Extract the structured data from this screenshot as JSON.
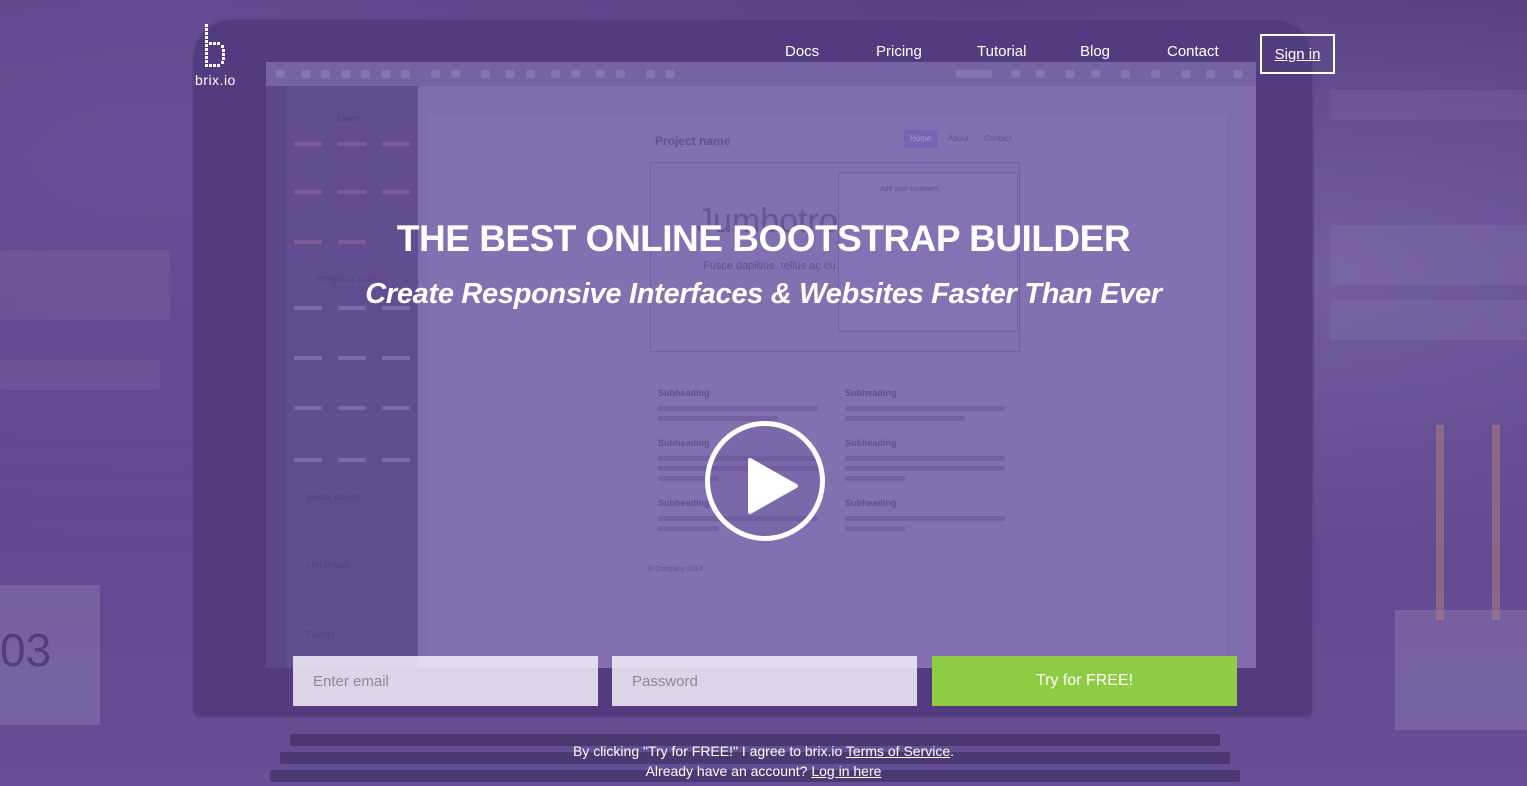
{
  "brand": {
    "name": "brix.io",
    "logo_icon": "brix-b-logo"
  },
  "nav": {
    "items": [
      {
        "label": "Docs"
      },
      {
        "label": "Pricing"
      },
      {
        "label": "Tutorial"
      },
      {
        "label": "Blog"
      },
      {
        "label": "Contact"
      }
    ],
    "signin_label": "Sign in"
  },
  "hero": {
    "title": "THE BEST ONLINE BOOTSTRAP BUILDER",
    "subtitle": "Create Responsive Interfaces & Websites Faster Than Ever",
    "play_icon": "play-icon"
  },
  "signup": {
    "email_placeholder": "Enter email",
    "password_placeholder": "Password",
    "submit_label": "Try for FREE!",
    "button_color": "#8ecc43"
  },
  "legal": {
    "terms_prefix": "By clicking \"Try for FREE!\" I agree to brix.io ",
    "terms_link": "Terms of Service",
    "terms_suffix": ".",
    "login_prefix": "Already have an account? ",
    "login_link": "Log in here"
  },
  "background_screen": {
    "project_name": "Project name",
    "nav_items": [
      "Home",
      "About",
      "Contact"
    ],
    "jumbotron_text": "Jumbotro",
    "jumbotron_line": "Fusce dapibus, tellus ac cu",
    "modal_title": "Add your comment",
    "subheadings": [
      "Subheading",
      "Subheading",
      "Subheading",
      "Subheading",
      "Subheading",
      "Subheading"
    ],
    "sidebar_labels": [
      "Alerts",
      "Progress bars",
      "Media object",
      "List group",
      "Panels"
    ],
    "footer": "© Company 2014",
    "desk_clock": "03"
  },
  "colors": {
    "overlay": "#5b4585",
    "accent": "#8ecc43"
  }
}
